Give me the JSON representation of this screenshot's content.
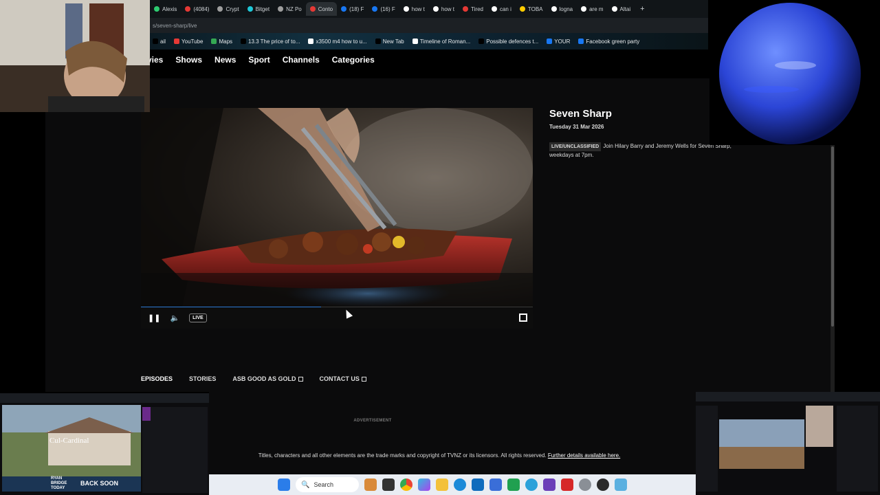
{
  "browser": {
    "tabs": [
      {
        "label": "Alexis",
        "color": "#2ecc71"
      },
      {
        "label": "(4084)",
        "color": "#e53935"
      },
      {
        "label": "Crypt",
        "color": "#9e9e9e"
      },
      {
        "label": "Bitget",
        "color": "#1ec8d8"
      },
      {
        "label": "NZ Po",
        "color": "#9e9e9e"
      },
      {
        "label": "Conto",
        "color": "#e53935",
        "active": true
      },
      {
        "label": "(18) F",
        "color": "#1877f2"
      },
      {
        "label": "(16) F",
        "color": "#1877f2"
      },
      {
        "label": "how t",
        "color": "#ffffff"
      },
      {
        "label": "how t",
        "color": "#ffffff"
      },
      {
        "label": "Tired",
        "color": "#e53935"
      },
      {
        "label": "can i",
        "color": "#ffffff"
      },
      {
        "label": "TOBA",
        "color": "#ffcc00"
      },
      {
        "label": "logna",
        "color": "#ffffff"
      },
      {
        "label": "are m",
        "color": "#ffffff"
      },
      {
        "label": "Altai",
        "color": "#ffffff"
      }
    ],
    "new_tab": "+",
    "address": "s/seven-sharp/live",
    "bookmarks": [
      {
        "label": "ail",
        "color": "#000000"
      },
      {
        "label": "YouTube",
        "color": "#e53935"
      },
      {
        "label": "Maps",
        "color": "#34a853"
      },
      {
        "label": "13.3 The price of to...",
        "color": "#000000"
      },
      {
        "label": "x3500 m4 how to u...",
        "color": "#ffffff"
      },
      {
        "label": "New Tab",
        "color": "#000000"
      },
      {
        "label": "Timeline of Roman...",
        "color": "#ffffff"
      },
      {
        "label": "Possible defences t...",
        "color": "#000000"
      },
      {
        "label": "YOUR",
        "color": "#1877f2"
      },
      {
        "label": "Facebook green party",
        "color": "#1877f2"
      }
    ]
  },
  "site": {
    "nav": [
      "vies",
      "Shows",
      "News",
      "Sport",
      "Channels",
      "Categories"
    ],
    "player": {
      "live_label": "LIVE",
      "progress": 0.46,
      "accent": "#2d7bd6"
    },
    "show": {
      "title": "Seven Sharp",
      "date": "Tuesday 31 Mar 2026",
      "badge": "LIVE/UNCLASSIFIED",
      "description": "Join Hilary Barry and Jeremy Wells for Seven Sharp, weekdays at 7pm."
    },
    "tabs": [
      {
        "label": "EPISODES",
        "active": true,
        "external": false
      },
      {
        "label": "STORIES",
        "active": false,
        "external": false
      },
      {
        "label": "ASB GOOD AS GOLD",
        "active": false,
        "external": true
      },
      {
        "label": "CONTACT US",
        "active": false,
        "external": true
      }
    ],
    "advertisement_label": "ADVERTISEMENT",
    "copyright": "Titles, characters and all other elements are the trade marks and copyright of TVNZ or its licensors. All rights reserved.",
    "copyright_link": "Further details available here."
  },
  "overlays": {
    "bl_thumb": {
      "caption": "Cul-Cardinal",
      "ticker": "BACK SOON",
      "brand": "RYAN BRIDGE TODAY"
    }
  },
  "taskbar": {
    "search_placeholder": "Search",
    "icons": [
      "windows-start-icon",
      "search-icon",
      "widgets-icon",
      "task-view-icon",
      "chrome-icon",
      "copilot-icon",
      "file-explorer-icon",
      "edge-icon",
      "outlook-icon",
      "store-icon",
      "phone-link-icon",
      "telegram-icon",
      "purple-app-icon",
      "red-app-icon",
      "settings-icon",
      "obs-icon",
      "photos-icon"
    ]
  }
}
